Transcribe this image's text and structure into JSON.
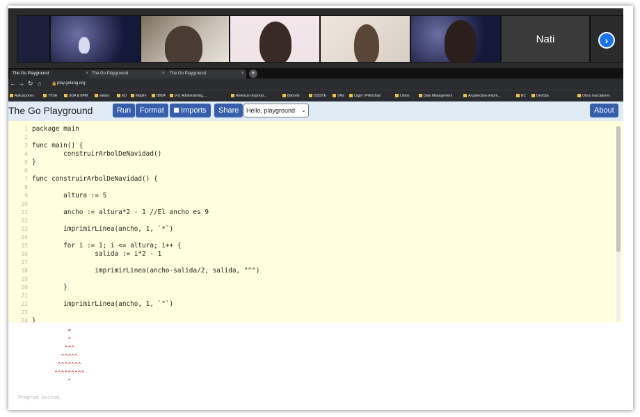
{
  "video_call": {
    "participant_name": "Nati",
    "next_icon": "chevron-right-icon"
  },
  "browser": {
    "tabs": [
      {
        "label": "The Go Playground"
      },
      {
        "label": "The Go Playground"
      },
      {
        "label": "The Go Playground"
      }
    ],
    "url": "play.golang.org",
    "bookmarks": [
      "Aplicaciones",
      "TVSA",
      "SOA & BPM",
      "webex",
      "ED",
      "Mapfre",
      "BBVA",
      "9-9_Administering_...",
      "American Express...",
      "Banorte",
      "ISSSTE",
      "VMs",
      "Login | Piktochart",
      "Libros",
      "Data Management",
      "Arquitectura empre...",
      "EC",
      "DevOps",
      "Otros marcadores"
    ]
  },
  "playground": {
    "title": "The Go Playground",
    "run": "Run",
    "format": "Format",
    "imports": "Imports",
    "share": "Share",
    "example_selected": "Hello, playground",
    "about": "About"
  },
  "code_lines": [
    {
      "n": "1",
      "text": "package main"
    },
    {
      "n": "2",
      "text": ""
    },
    {
      "n": "3",
      "text": "func main() {"
    },
    {
      "n": "4",
      "text": "        construirArbolDeNavidad()"
    },
    {
      "n": "5",
      "text": "}"
    },
    {
      "n": "6",
      "text": ""
    },
    {
      "n": "7",
      "text": "func construirArbolDeNavidad() {"
    },
    {
      "n": "8",
      "text": ""
    },
    {
      "n": "9",
      "text": "        altura := 5"
    },
    {
      "n": "10",
      "text": ""
    },
    {
      "n": "11",
      "text": "        ancho := altura*2 - 1 //El ancho es 9"
    },
    {
      "n": "12",
      "text": ""
    },
    {
      "n": "13",
      "text": "        imprimirLinea(ancho, 1, `*`)"
    },
    {
      "n": "14",
      "text": ""
    },
    {
      "n": "15",
      "text": "        for i := 1; i <= altura; i++ {"
    },
    {
      "n": "16",
      "text": "                salida := i*2 - 1"
    },
    {
      "n": "17",
      "text": ""
    },
    {
      "n": "18",
      "text": "                imprimirLinea(ancho-salida/2, salida, \"^\")"
    },
    {
      "n": "19",
      "text": ""
    },
    {
      "n": "20",
      "text": "        }"
    },
    {
      "n": "21",
      "text": ""
    },
    {
      "n": "22",
      "text": "        imprimirLinea(ancho, 1, `\"`)"
    },
    {
      "n": "23",
      "text": ""
    },
    {
      "n": "24",
      "text": "}"
    }
  ],
  "output_lines": [
    "         *",
    "         ^",
    "        ^^^",
    "       ^^^^^",
    "      ^^^^^^^",
    "     ^^^^^^^^^",
    "         \""
  ],
  "output_footer": "Program exited."
}
